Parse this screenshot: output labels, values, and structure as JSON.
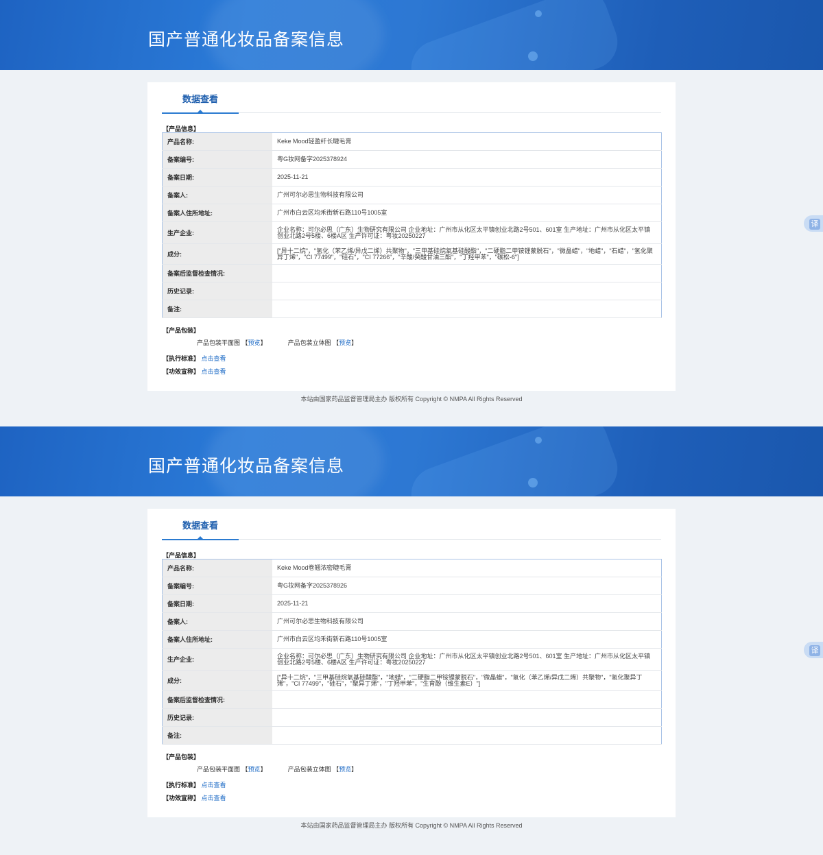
{
  "records": [
    {
      "banner_title": "国产普通化妆品备案信息",
      "tab_label": "数据查看",
      "section_product": "【产品信息】",
      "rows": [
        {
          "key": "产品名称:",
          "value": "Keke Mood轻盈纤长睫毛膏"
        },
        {
          "key": "备案编号:",
          "value": "粤G妆网备字2025378924"
        },
        {
          "key": "备案日期:",
          "value": "2025-11-21"
        },
        {
          "key": "备案人:",
          "value": "广州可尔必思生物科技有限公司"
        },
        {
          "key": "备案人住所地址:",
          "value": "广州市白云区均禾街新石路110号1005室"
        },
        {
          "key": "生产企业:",
          "value": "企业名称：可尔必思（广东）生物研究有限公司 企业地址：广州市从化区太平镇创业北路2号501、601室 生产地址：广州市从化区太平镇创业北路2号5楼、6楼A区 生产许可证：粤妆20250227"
        },
        {
          "key": "成分:",
          "value": "[\"异十二烷\"，\"氢化（苯乙烯/异戊二烯）共聚物\"，\"三甲基硅烷氧基硅酸酯\"，\"二硬脂二甲铵锂蒙脱石\"，\"微晶蜡\"，\"地蜡\"，\"石蜡\"，\"氢化聚异丁烯\"，\"CI 77499\"，\"硅石\"，\"CI 77266\"，\"辛酸/癸酸甘油三酯\"，\"丁羟甲苯\"，\"碳松-6\"]"
        },
        {
          "key": "备案后监督检查情况:",
          "value": ""
        },
        {
          "key": "历史记录:",
          "value": ""
        },
        {
          "key": "备注:",
          "value": ""
        }
      ],
      "section_packaging": "【产品包装】",
      "pack_flat_label": "产品包装平面图",
      "pack_flat_link": "预览",
      "pack_3d_label": "产品包装立体图",
      "pack_3d_link": "预览",
      "standard_label": "【执行标准】",
      "standard_link": "点击查看",
      "efficacy_label": "【功效宣称】",
      "efficacy_link": "点击查看",
      "footer": "本站由国家药品监督管理局主办 版权所有 Copyright © NMPA All Rights Reserved",
      "translate_label": "译"
    },
    {
      "banner_title": "国产普通化妆品备案信息",
      "tab_label": "数据查看",
      "section_product": "【产品信息】",
      "rows": [
        {
          "key": "产品名称:",
          "value": "Keke Mood卷翘浓密睫毛膏"
        },
        {
          "key": "备案编号:",
          "value": "粤G妆网备字2025378926"
        },
        {
          "key": "备案日期:",
          "value": "2025-11-21"
        },
        {
          "key": "备案人:",
          "value": "广州可尔必思生物科技有限公司"
        },
        {
          "key": "备案人住所地址:",
          "value": "广州市白云区均禾街新石路110号1005室"
        },
        {
          "key": "生产企业:",
          "value": "企业名称：可尔必思（广东）生物研究有限公司 企业地址：广州市从化区太平镇创业北路2号501、601室 生产地址：广州市从化区太平镇创业北路2号5楼、6楼A区 生产许可证：粤妆20250227"
        },
        {
          "key": "成分:",
          "value": "[\"异十二烷\"，\"三甲基硅烷氧基硅酸酯\"，\"地蜡\"，\"二硬脂二甲铵锂蒙脱石\"，\"微晶蜡\"，\"氢化（苯乙烯/异戊二烯）共聚物\"，\"氢化聚异丁烯\"，\"CI 77499\"，\"硅石\"，\"聚异丁烯\"，\"丁羟甲苯\"，\"生育酚（维生素E）\"]"
        },
        {
          "key": "备案后监督检查情况:",
          "value": ""
        },
        {
          "key": "历史记录:",
          "value": ""
        },
        {
          "key": "备注:",
          "value": ""
        }
      ],
      "section_packaging": "【产品包装】",
      "pack_flat_label": "产品包装平面图",
      "pack_flat_link": "预览",
      "pack_3d_label": "产品包装立体图",
      "pack_3d_link": "预览",
      "standard_label": "【执行标准】",
      "standard_link": "点击查看",
      "efficacy_label": "【功效宣称】",
      "efficacy_link": "点击查看",
      "footer": "本站由国家药品监督管理局主办 版权所有 Copyright © NMPA All Rights Reserved",
      "translate_label": "译"
    }
  ]
}
